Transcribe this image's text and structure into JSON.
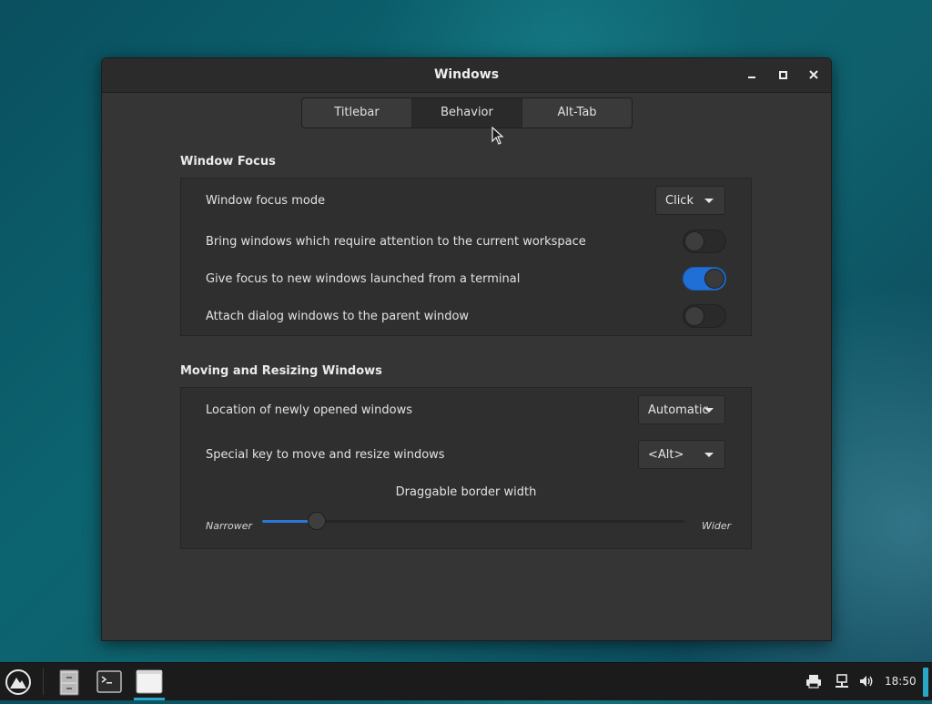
{
  "window": {
    "title": "Windows"
  },
  "tabs": [
    {
      "label": "Titlebar",
      "active": false
    },
    {
      "label": "Behavior",
      "active": true
    },
    {
      "label": "Alt-Tab",
      "active": false
    }
  ],
  "focus": {
    "section_title": "Window Focus",
    "mode_label": "Window focus mode",
    "mode_value": "Click",
    "attention_label": "Bring windows which require attention to the current workspace",
    "attention_on": false,
    "terminal_label": "Give focus to new windows launched from a terminal",
    "terminal_on": true,
    "attach_label": "Attach dialog windows to the parent window",
    "attach_on": false
  },
  "moving": {
    "section_title": "Moving and Resizing Windows",
    "location_label": "Location of newly opened windows",
    "location_value": "Automatic",
    "special_key_label": "Special key to move and resize windows",
    "special_key_value": "<Alt>",
    "border_caption": "Draggable border width",
    "border_min_label": "Narrower",
    "border_max_label": "Wider",
    "border_level": 0.13
  },
  "taskbar": {
    "clock": "18:50"
  },
  "colors": {
    "accent": "#1f6fd6",
    "panel_highlight": "#2aa6c8"
  }
}
